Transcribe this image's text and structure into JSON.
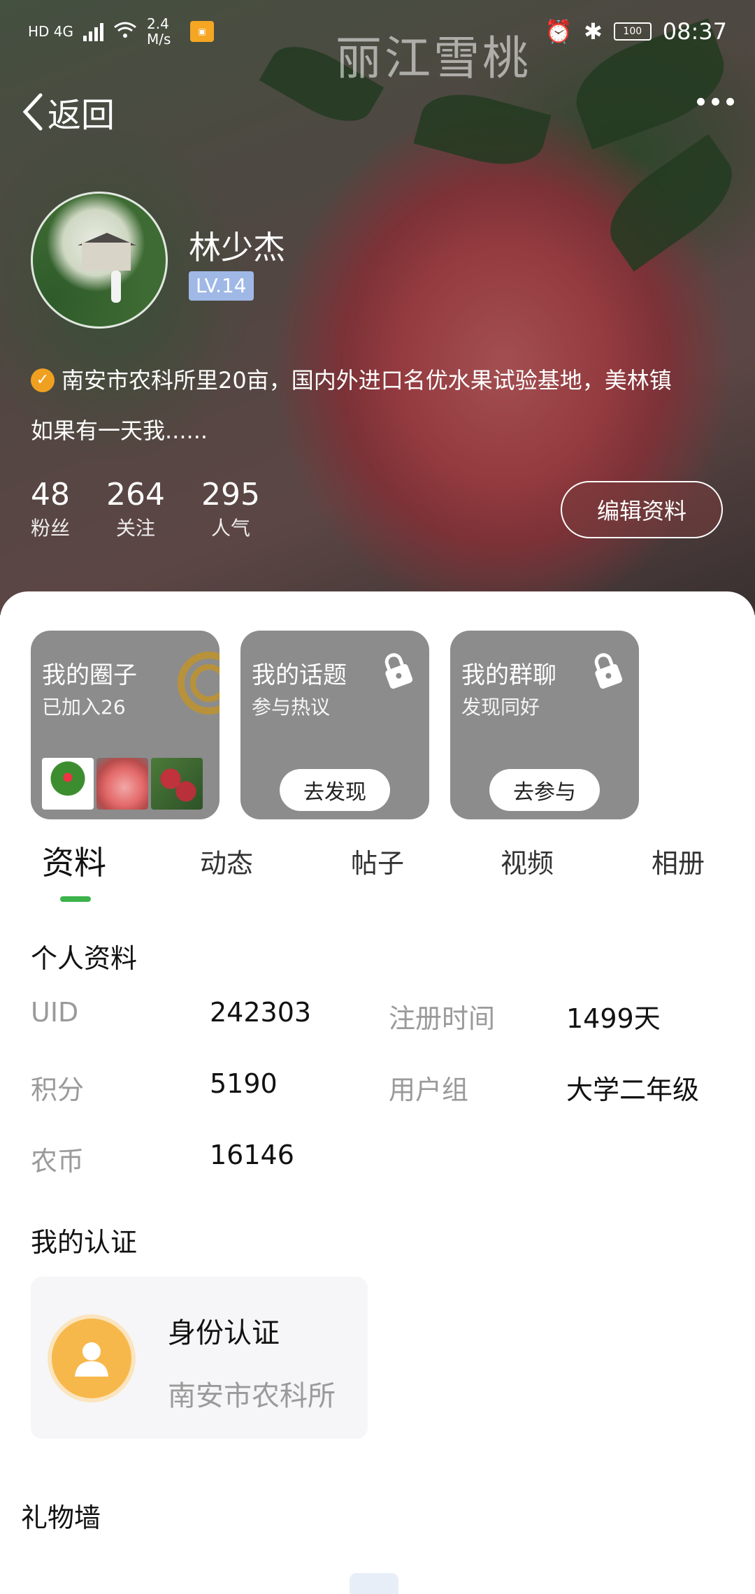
{
  "status_bar": {
    "network": "HD 4G",
    "speed": "2.4 M/s",
    "battery": "100",
    "time": "08:37"
  },
  "hero": {
    "watermark": "丽江雪桃",
    "back_label": "返回",
    "username": "林少杰",
    "level": "LV.14",
    "bio_line1": "南安市农科所里20亩，国内外进口名优水果试验基地，美林镇",
    "bio_line2": "如果有一天我......",
    "stats": [
      {
        "value": "48",
        "label": "粉丝"
      },
      {
        "value": "264",
        "label": "关注"
      },
      {
        "value": "295",
        "label": "人气"
      }
    ],
    "edit_label": "编辑资料"
  },
  "cards": {
    "circle": {
      "title": "我的圈子",
      "sub": "已加入26"
    },
    "topic": {
      "title": "我的话题",
      "sub": "参与热议",
      "button": "去发现"
    },
    "group": {
      "title": "我的群聊",
      "sub": "发现同好",
      "button": "去参与"
    }
  },
  "tabs": [
    "资料",
    "动态",
    "帖子",
    "视频",
    "相册"
  ],
  "profile": {
    "section_title": "个人资料",
    "uid_label": "UID",
    "uid_value": "242303",
    "reg_label": "注册时间",
    "reg_value": "1499天",
    "points_label": "积分",
    "points_value": "5190",
    "group_label": "用户组",
    "group_value": "大学二年级",
    "coin_label": "农币",
    "coin_value": "16146"
  },
  "certification": {
    "section_title": "我的认证",
    "title": "身份认证",
    "sub": "南安市农科所"
  },
  "gift_wall": {
    "section_title": "礼物墙"
  }
}
